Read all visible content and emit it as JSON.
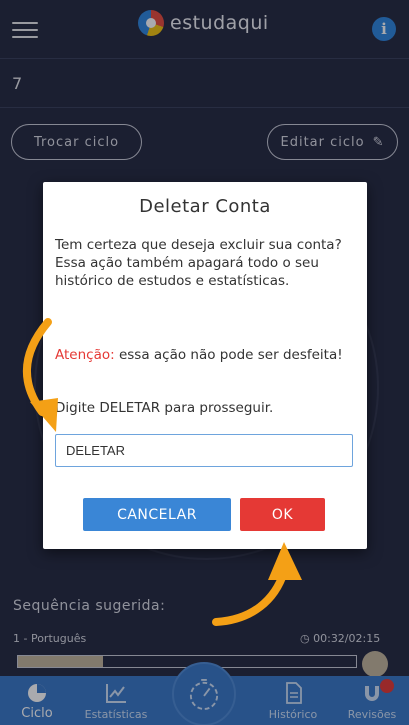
{
  "header": {
    "app_name": "estudaqui",
    "menu_icon": "hamburger-menu-icon",
    "info_icon": "info-icon",
    "info_glyph": "i",
    "brand_color": "#3a78c6"
  },
  "cycle": {
    "number": "7",
    "change_label": "Trocar ciclo",
    "edit_label": "Editar ciclo"
  },
  "sequence": {
    "label": "Sequência sugerida:",
    "item_label": "1 - Português",
    "time": "00:32/02:15",
    "progress": 0.25
  },
  "bottom_nav": {
    "items": [
      {
        "label": "Ciclo",
        "icon": "pie-chart-icon"
      },
      {
        "label": "Estatísticas",
        "icon": "line-chart-icon"
      },
      {
        "label": "Histórico",
        "icon": "document-icon"
      },
      {
        "label": "Revisões",
        "icon": "magnet-icon"
      }
    ],
    "center_icon": "stopwatch-icon"
  },
  "dialog": {
    "title": "Deletar Conta",
    "message": "Tem certeza que deseja excluir sua conta? Essa ação também apagará todo o seu histórico de estudos e estatísticas.",
    "warning_strong": "Atenção:",
    "warning_text": " essa ação não pode ser desfeita!",
    "hint": "Digite DELETAR para prosseguir.",
    "input_value": "DELETAR",
    "cancel_label": "CANCELAR",
    "ok_label": "OK",
    "colors": {
      "cancel": "#3a86d6",
      "ok": "#e53935",
      "warning": "#e53935"
    }
  }
}
